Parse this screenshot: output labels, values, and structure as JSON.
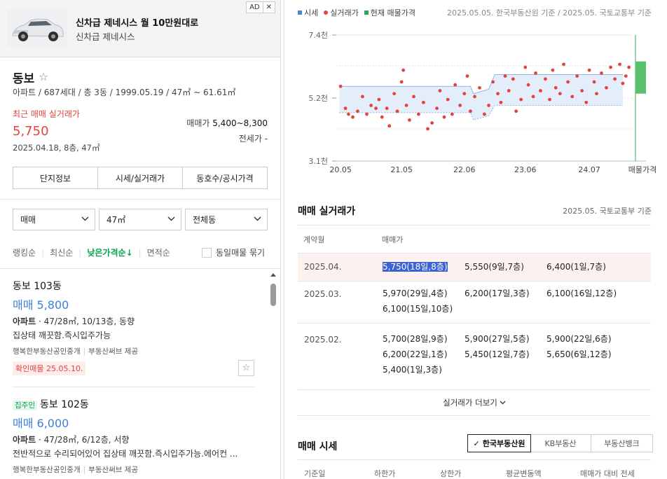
{
  "ad": {
    "title": "신차급 제네시스 월 10만원대로",
    "subtitle": "신차급 제네시스",
    "badge": "AD",
    "close": "✕"
  },
  "complex": {
    "name": "동보",
    "info": "아파트 / 687세대 / 총 3동 / 1999.05.19 / 47㎡ ~ 61.61㎡",
    "recent_label": "최근 매매 실거래가",
    "recent_price": "5,750",
    "recent_date": "2025.04.18, 8층, 47㎡",
    "sale_label": "매매가",
    "sale_range": "5,400~8,300",
    "jeonse": "전세가 -"
  },
  "tabs": [
    "단지정보",
    "시세/실거래가",
    "동호수/공시가격"
  ],
  "filters": {
    "trade": "매매",
    "area": "47㎡",
    "dong": "전체동"
  },
  "sort": {
    "items": [
      "랭킹순",
      "최신순",
      "낮은가격순↓",
      "면적순"
    ],
    "active_index": 2,
    "same_group": "동일매물 묶기"
  },
  "listings": [
    {
      "title": "동보 103동",
      "price": "매매 5,800",
      "spec_type": "아파트",
      "spec": " · 47/28㎡, 10/13층, 동향",
      "desc": "집상태 깨끗함.즉시입주가능",
      "agent": "행복한부동산공인중개",
      "provider": "부동산써브 제공",
      "confirm": "확인매물 25.05.10."
    },
    {
      "tag": "집주인",
      "title": "동보 102동",
      "price": "매매 6,000",
      "spec_type": "아파트",
      "spec": " · 47/28㎡, 6/12층, 서향",
      "desc": "전반적으로 수리되어있어 집상태 깨끗함.즉시입주가능.에어컨 ...",
      "agent": "행복한부동산공인중개",
      "provider": "부동산써브 제공"
    }
  ],
  "chart_legend": {
    "items": [
      {
        "label": "시세",
        "color": "#4a86d8"
      },
      {
        "label": "실거래가",
        "color": "#e5423c"
      },
      {
        "label": "현재 매물가격",
        "color": "#2fa84f"
      }
    ],
    "source": "2025.05.05. 한국부동산원 기준 / 2025.05. 국토교통부 기준"
  },
  "chart_data": {
    "type": "scatter",
    "y_ticks": [
      "7.4천",
      "5.2천",
      "3.1천"
    ],
    "ylim": [
      3100,
      7400
    ],
    "x_ticks": [
      "20.05",
      "21.05",
      "22.06",
      "23.06",
      "24.07",
      "매물가격"
    ],
    "series": [
      {
        "name": "시세",
        "type": "band",
        "color": "#4a86d8",
        "x": [
          2020.4,
          2022.55,
          2022.6,
          2022.85,
          2022.95,
          2025.05
        ],
        "upper": [
          5650,
          5650,
          5400,
          5550,
          6050,
          6050
        ],
        "lower": [
          4750,
          4750,
          4500,
          4650,
          5000,
          5000
        ]
      },
      {
        "name": "실거래가",
        "type": "scatter",
        "color": "#e5423c",
        "points": [
          [
            2020.42,
            5650
          ],
          [
            2020.5,
            4900
          ],
          [
            2020.55,
            4700
          ],
          [
            2020.62,
            4600
          ],
          [
            2020.7,
            4800
          ],
          [
            2020.78,
            5300
          ],
          [
            2020.85,
            4700
          ],
          [
            2020.92,
            5000
          ],
          [
            2021.0,
            4900
          ],
          [
            2021.05,
            5200
          ],
          [
            2021.1,
            4600
          ],
          [
            2021.18,
            4900
          ],
          [
            2021.22,
            4300
          ],
          [
            2021.3,
            5400
          ],
          [
            2021.35,
            4800
          ],
          [
            2021.42,
            5800
          ],
          [
            2021.45,
            6200
          ],
          [
            2021.5,
            5000
          ],
          [
            2021.55,
            4500
          ],
          [
            2021.62,
            5300
          ],
          [
            2021.7,
            4700
          ],
          [
            2021.78,
            5100
          ],
          [
            2021.85,
            4200
          ],
          [
            2021.92,
            4400
          ],
          [
            2022.0,
            4900
          ],
          [
            2022.05,
            5500
          ],
          [
            2022.12,
            4600
          ],
          [
            2022.18,
            5200
          ],
          [
            2022.25,
            4700
          ],
          [
            2022.3,
            5700
          ],
          [
            2022.38,
            5000
          ],
          [
            2022.45,
            5400
          ],
          [
            2022.5,
            6000
          ],
          [
            2022.55,
            4800
          ],
          [
            2022.62,
            5300
          ],
          [
            2022.7,
            5600
          ],
          [
            2022.78,
            4700
          ],
          [
            2022.85,
            5000
          ],
          [
            2022.92,
            5800
          ],
          [
            2023.0,
            5400
          ],
          [
            2023.05,
            5100
          ],
          [
            2023.12,
            6000
          ],
          [
            2023.18,
            5500
          ],
          [
            2023.25,
            5900
          ],
          [
            2023.3,
            4800
          ],
          [
            2023.38,
            5200
          ],
          [
            2023.45,
            6300
          ],
          [
            2023.5,
            5700
          ],
          [
            2023.58,
            5300
          ],
          [
            2023.62,
            6100
          ],
          [
            2023.7,
            5500
          ],
          [
            2023.78,
            5900
          ],
          [
            2023.85,
            5200
          ],
          [
            2023.9,
            6200
          ],
          [
            2023.95,
            5600
          ],
          [
            2024.02,
            5400
          ],
          [
            2024.08,
            6400
          ],
          [
            2024.15,
            5800
          ],
          [
            2024.22,
            5300
          ],
          [
            2024.3,
            6000
          ],
          [
            2024.38,
            5500
          ],
          [
            2024.45,
            5100
          ],
          [
            2024.5,
            6200
          ],
          [
            2024.58,
            5800
          ],
          [
            2024.62,
            5400
          ],
          [
            2024.7,
            6100
          ],
          [
            2024.78,
            5600
          ],
          [
            2024.85,
            6300
          ],
          [
            2024.92,
            5900
          ],
          [
            2025.0,
            6400
          ],
          [
            2025.05,
            5750
          ],
          [
            2025.1,
            6000
          ],
          [
            2025.15,
            6300
          ]
        ]
      },
      {
        "name": "현재 매물가격",
        "type": "bar",
        "color": "#2fa84f",
        "low": 5400,
        "high": 6500
      }
    ]
  },
  "trades": {
    "title": "매매 실거래가",
    "source": "2025.05. 국토교통부 기준",
    "col_month": "계약월",
    "col_price": "매매가",
    "rows": [
      {
        "month": "2025.04.",
        "prices": [
          "5,750(18일,8층)",
          "5,550(9일,7층)",
          "6,400(1일,7층)"
        ]
      },
      {
        "month": "2025.03.",
        "prices": [
          "5,970(29일,4층)",
          "6,200(17일,3층)",
          "6,100(16일,12층)",
          "6,100(15일,10층)"
        ]
      },
      {
        "month": "2025.02.",
        "prices": [
          "5,700(28일,9층)",
          "5,900(27일,5층)",
          "5,900(22일,6층)",
          "6,200(22일,1층)",
          "5,450(12일,7층)",
          "5,650(6일,12층)",
          "5,400(1일,3층)"
        ]
      }
    ],
    "more": "실거래가 더보기"
  },
  "market": {
    "title": "매매 시세",
    "sources": [
      "한국부동산원",
      "KB부동산",
      "부동산뱅크"
    ],
    "columns": [
      "기준일",
      "하한가",
      "상한가",
      "평균변동액",
      "매매가 대비 전세"
    ]
  }
}
